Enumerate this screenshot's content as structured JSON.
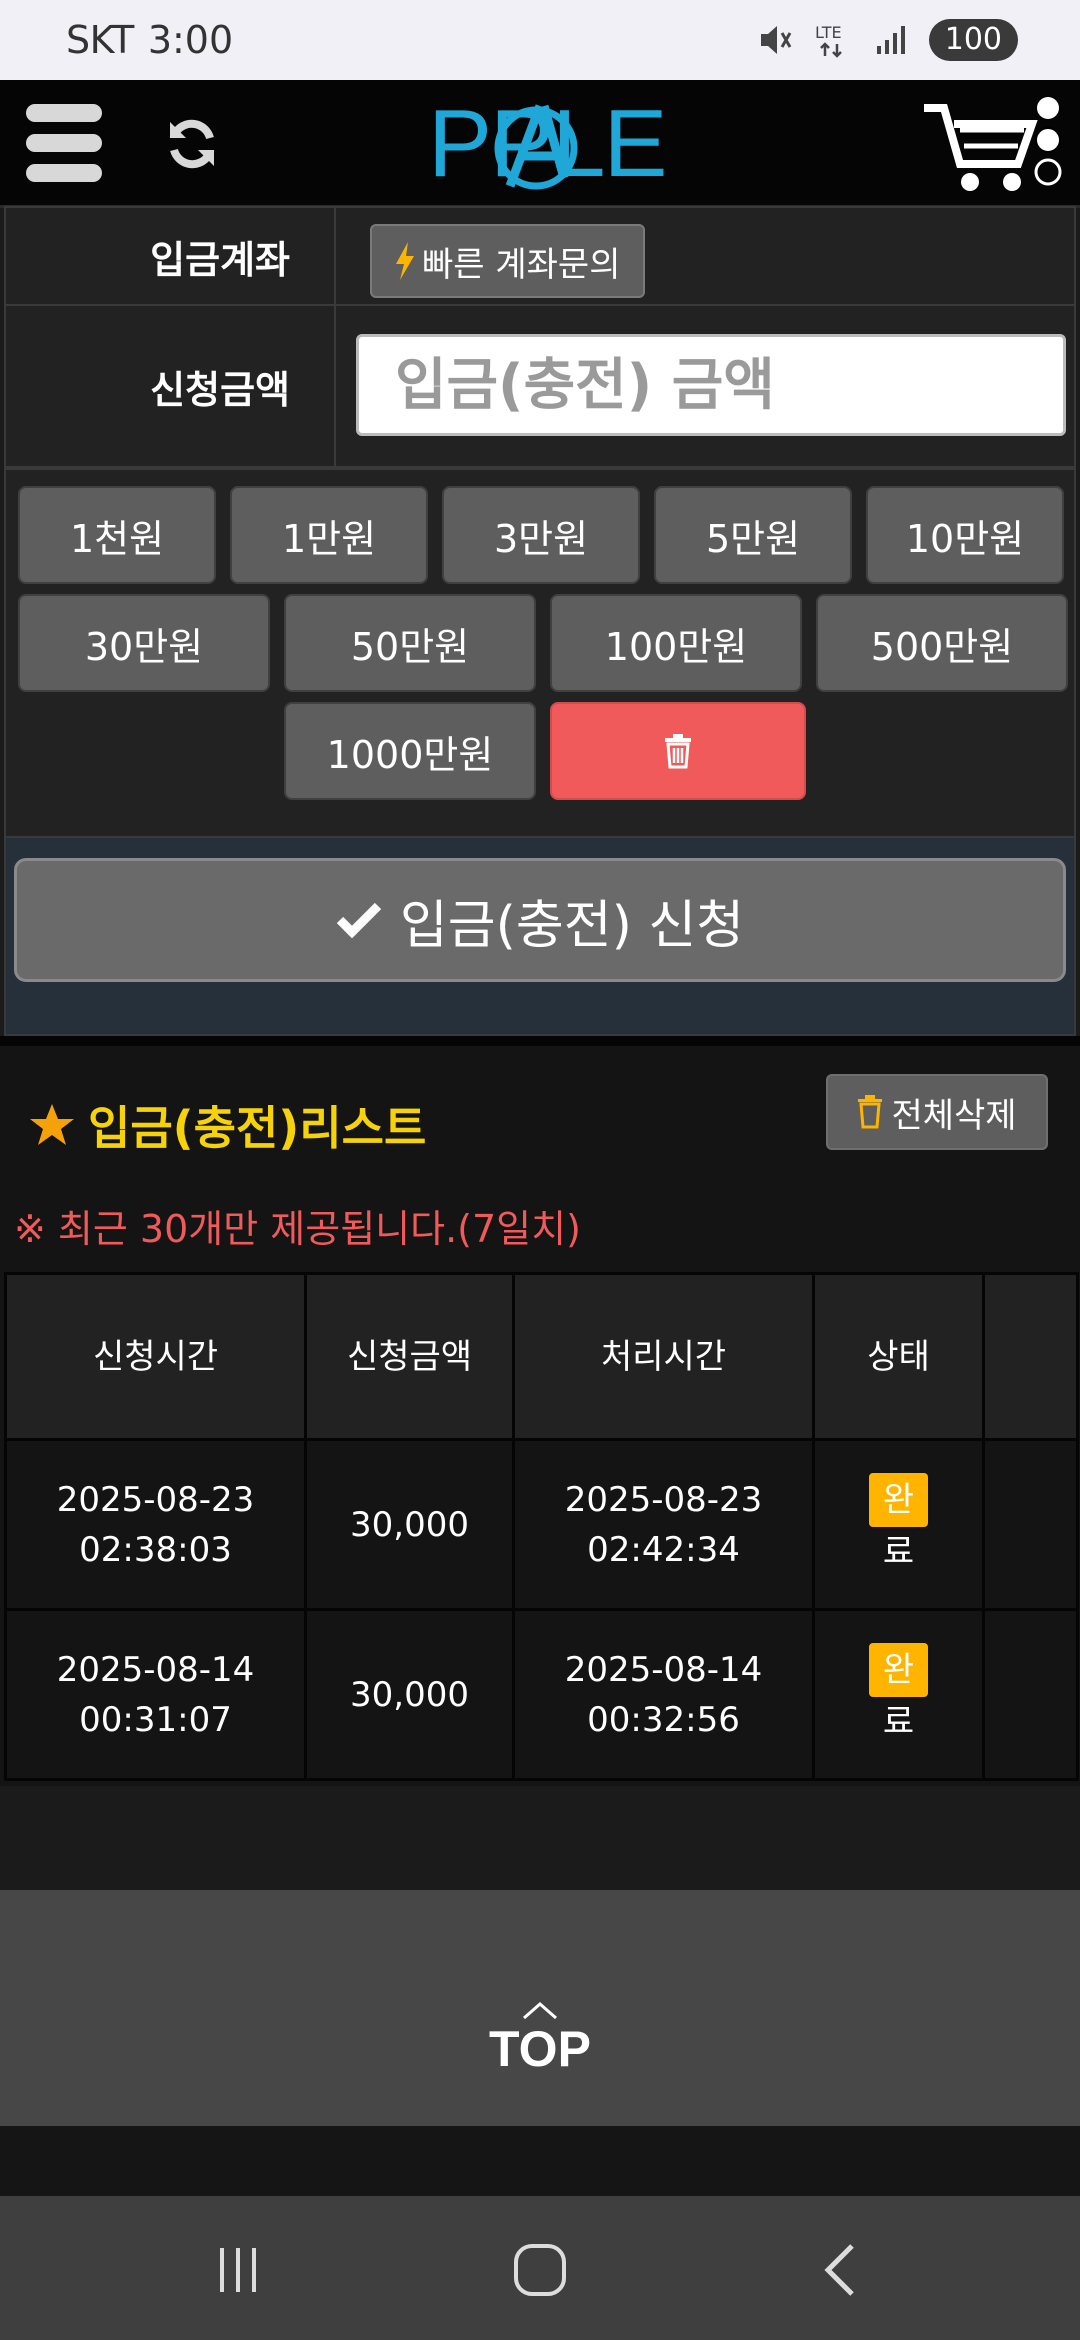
{
  "status_bar": {
    "carrier": "SKT",
    "time": "3:00",
    "network": "LTE",
    "battery": "100"
  },
  "header": {
    "logo_text": "PPLE",
    "menu_icon": "hamburger-menu-icon",
    "refresh_icon": "refresh-icon",
    "cart_icon": "cart-icon"
  },
  "deposit_form": {
    "account_label": "입금계좌",
    "quick_inquiry_label": "빠른 계좌문의",
    "amount_label": "신청금액",
    "amount_placeholder": "입금(충전) 금액",
    "amount_value": "",
    "chips": [
      "1천원",
      "1만원",
      "3만원",
      "5만원",
      "10만원",
      "30만원",
      "50만원",
      "100만원",
      "500만원",
      "1000만원"
    ],
    "submit_label": "입금(충전) 신청"
  },
  "deposit_list": {
    "title": "입금(충전)리스트",
    "delete_all_label": "전체삭제",
    "notice": "※ 최근 30개만 제공됩니다.(7일치)",
    "columns": [
      "신청시간",
      "신청금액",
      "처리시간",
      "상태"
    ],
    "rows": [
      {
        "request_date": "2025-08-23",
        "request_time": "02:38:03",
        "amount": "30,000",
        "processed_date": "2025-08-23",
        "processed_time": "02:42:34",
        "status_first": "완",
        "status_rest": "료"
      },
      {
        "request_date": "2025-08-14",
        "request_time": "00:31:07",
        "amount": "30,000",
        "processed_date": "2025-08-14",
        "processed_time": "00:32:56",
        "status_first": "완",
        "status_rest": "료"
      }
    ]
  },
  "footer": {
    "top_label": "TOP"
  },
  "colors": {
    "accent_blue": "#1fa7d8",
    "title_yellow": "#f5d20a",
    "warning_red": "#f05a5a",
    "badge_orange": "#ffb400"
  }
}
